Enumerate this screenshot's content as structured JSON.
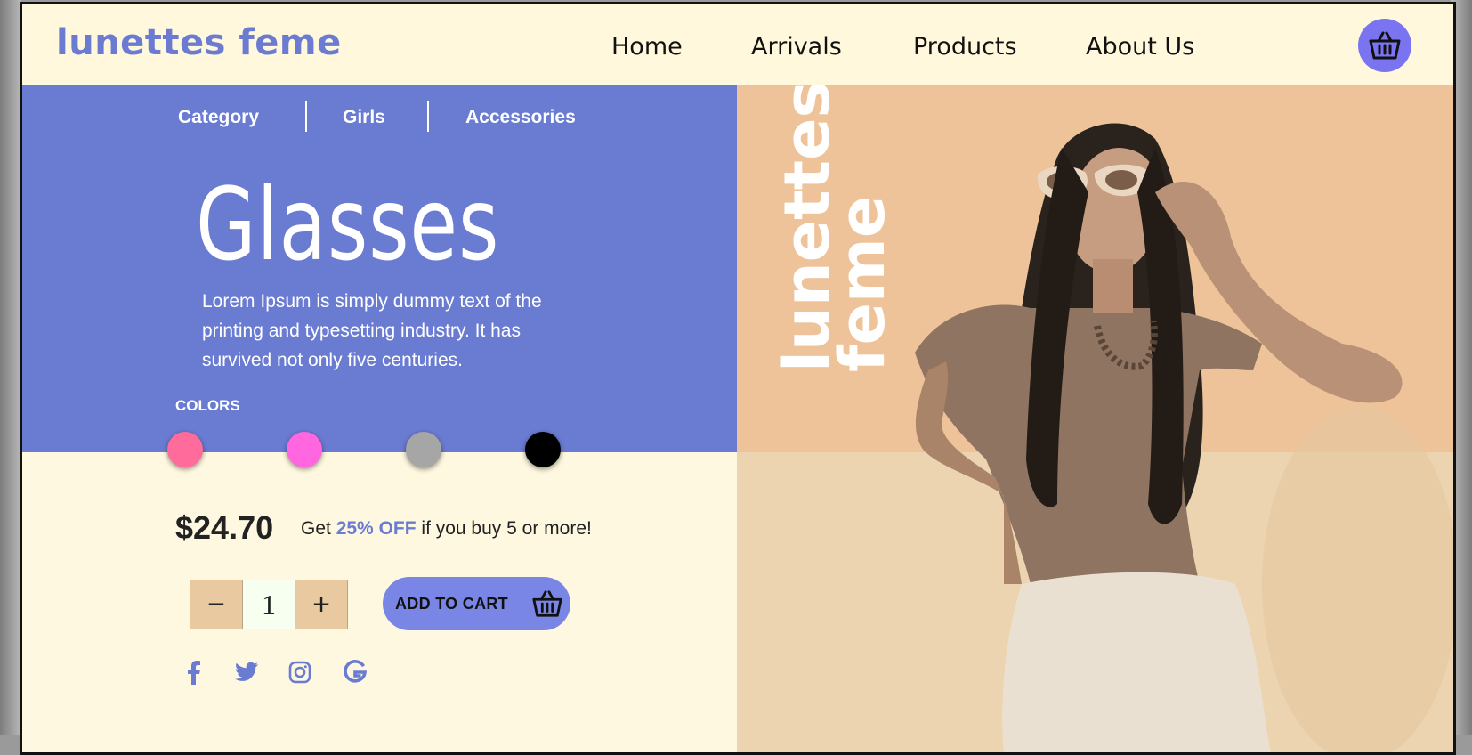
{
  "header": {
    "logo": "lunettes feme",
    "nav": [
      "Home",
      "Arrivals",
      "Products",
      "About Us"
    ],
    "cart_icon": "basket-icon"
  },
  "breadcrumb": [
    "Category",
    "Girls",
    "Accessories"
  ],
  "product": {
    "title": "Glasses",
    "description": "Lorem Ipsum is simply dummy text of the printing and typesetting industry. It has survived not only five centuries.",
    "colors_label": "COLORS",
    "colors": [
      "#ff6b9b",
      "#ff66e0",
      "#a6a6a6",
      "#000000"
    ],
    "price": "$24.70",
    "offer_prefix": "Get",
    "offer_highlight": "25% OFF",
    "offer_suffix": "if you buy 5 or more!",
    "quantity": "1",
    "minus_label": "−",
    "plus_label": "+",
    "add_to_cart": "ADD TO CART"
  },
  "social": [
    "facebook-icon",
    "twitter-icon",
    "instagram-icon",
    "google-icon"
  ],
  "hero": {
    "brand_line1": "lunettes",
    "brand_line2": "feme"
  },
  "theme": {
    "accent": "#6a7bd2",
    "cream": "#fff8dc",
    "peach": "#eec39a"
  }
}
